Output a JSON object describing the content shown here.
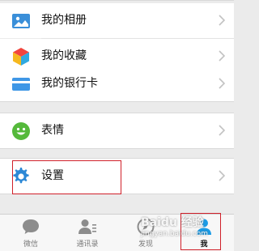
{
  "menu": {
    "album": "我的相册",
    "favorites": "我的收藏",
    "bank_card": "我的银行卡",
    "stickers": "表情",
    "settings": "设置"
  },
  "tabbar": {
    "chats": "微信",
    "contacts": "通讯录",
    "discover": "发现",
    "me": "我"
  },
  "watermark": {
    "brand": "Baidu 经验",
    "url": "jingyan.baidu.com"
  },
  "colors": {
    "highlight": "#d0202a",
    "background": "#ebebeb"
  }
}
